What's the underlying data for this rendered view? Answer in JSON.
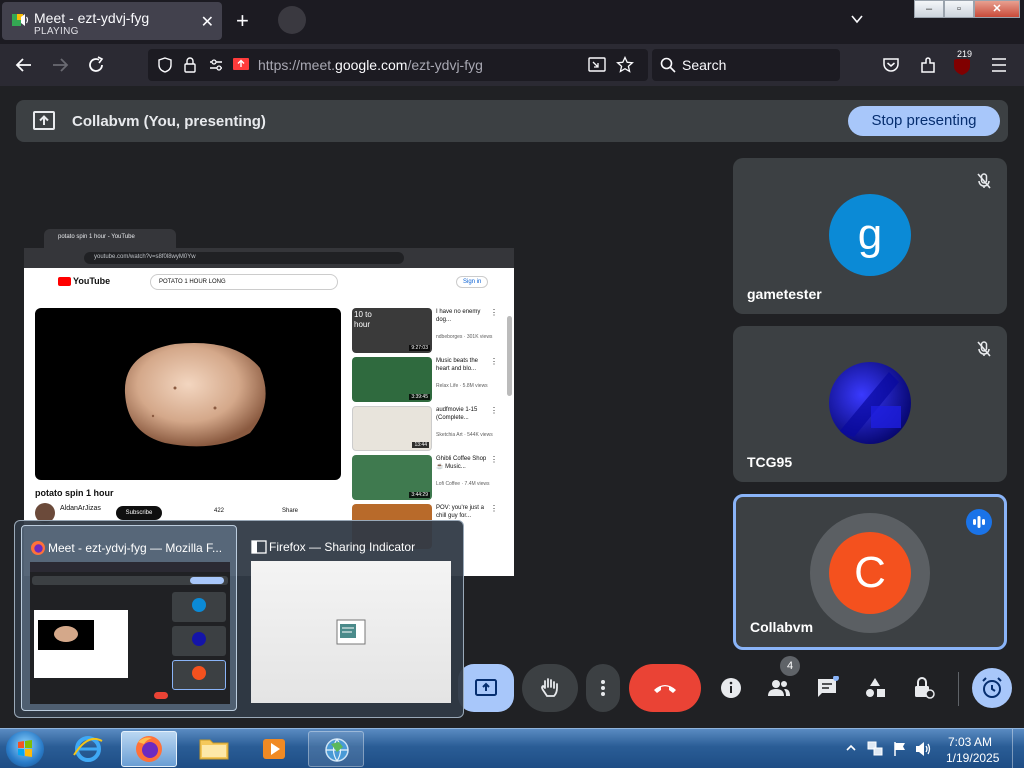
{
  "browser": {
    "tab": {
      "title": "Meet - ezt-ydvj-fyg",
      "status": "PLAYING",
      "close": "✕"
    },
    "new_tab": "+",
    "url_prefix": "https://meet.",
    "url_host": "google.com",
    "url_path": "/ezt-ydvj-fyg",
    "search_placeholder": "Search",
    "extension_badge": "219"
  },
  "presenting": {
    "text": "Collabvm (You, presenting)",
    "stop_label": "Stop presenting"
  },
  "shared_screen": {
    "tab_title": "potato spin 1 hour - YouTube",
    "url": "youtube.com/watch?v=s8f0l8wyM0Yw",
    "logo": "YouTube",
    "search_value": "POTATO 1 HOUR LONG",
    "signin": "Sign in",
    "video_title": "potato spin 1 hour",
    "channel": "AldanArJizas",
    "subscribe": "Subscribe",
    "likes": "422",
    "share": "Share",
    "recommendations": [
      {
        "title": "I have no enemy dog...",
        "meta": "ndbeborges · 301K views",
        "duration": "9:27:03",
        "thumb_text": "10 to hour",
        "color": "#3a3a3a"
      },
      {
        "title": "Music beats the heart and blo...",
        "meta": "Relax Life · 5.8M views",
        "duration": "3:39:45",
        "color": "#2f6a3e"
      },
      {
        "title": "audfmovie 1-15 (Complete...",
        "meta": "Sketchia Art · 544K views",
        "duration": "13:44",
        "color": "#e8e4dc"
      },
      {
        "title": "Ghibli Coffee Shop ☕ Music...",
        "meta": "Lofi Coffee · 7.4M views",
        "duration": "3:44:29",
        "color": "#3f7a4f"
      },
      {
        "title": "POV: you're just a chill guy for...",
        "meta": "",
        "duration": "",
        "color": "#b86a2a"
      }
    ]
  },
  "participants": [
    {
      "name": "gametester",
      "initial": "g",
      "color": "#0b8ad6",
      "muted": true,
      "speaking": false
    },
    {
      "name": "TCG95",
      "initial": "",
      "color": "#1414a8",
      "muted": true,
      "speaking": false
    },
    {
      "name": "Collabvm",
      "initial": "C",
      "color": "#f4511e",
      "muted": false,
      "speaking": true
    }
  ],
  "popup": {
    "window1": "Meet - ezt-ydvj-fyg — Mozilla F...",
    "window2": "Firefox — Sharing Indicator"
  },
  "controls": {
    "people_count": "4"
  },
  "taskbar": {
    "time": "7:03 AM",
    "date": "1/19/2025"
  },
  "colors": {
    "accent": "#a8c7fa",
    "end_call": "#ea4335",
    "meet_bg": "#202124"
  }
}
